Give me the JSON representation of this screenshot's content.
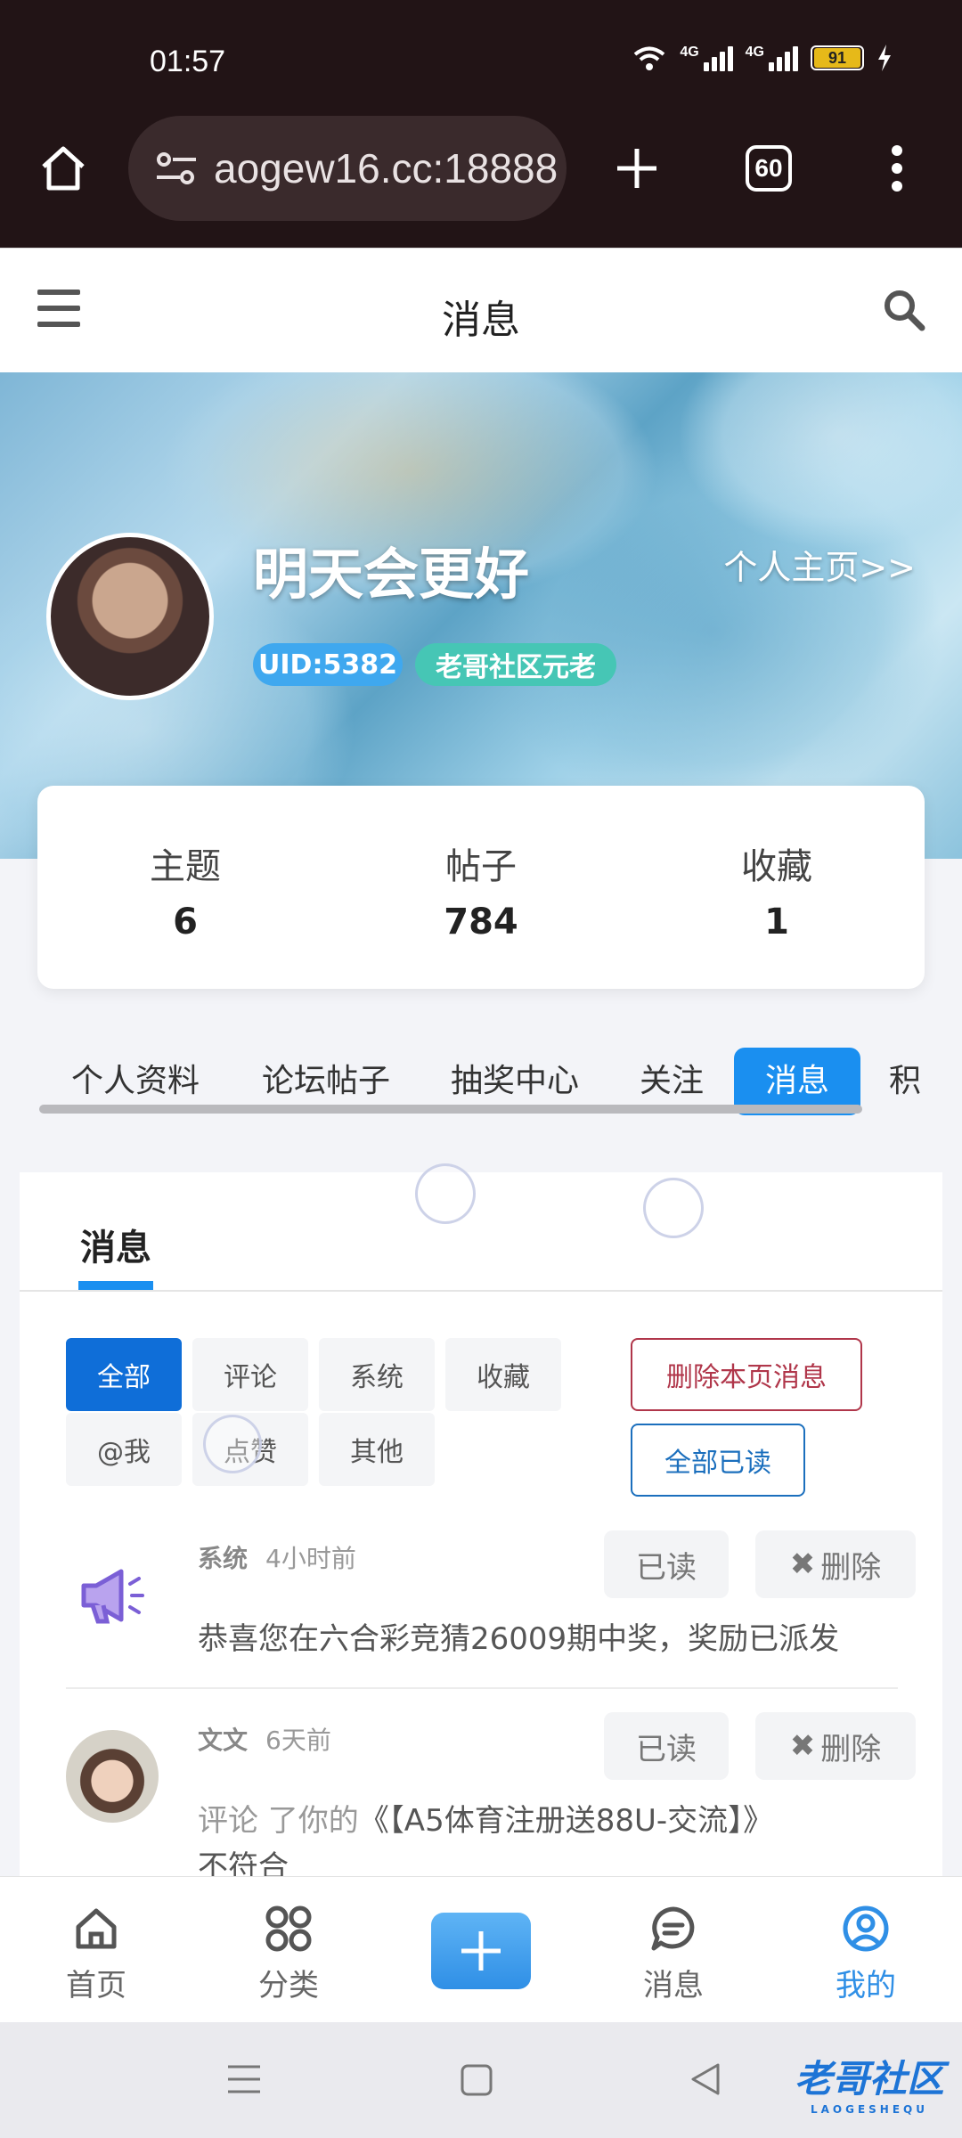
{
  "status_bar": {
    "time": "01:57",
    "battery": "91"
  },
  "browser": {
    "url_text": "aogew16.cc:18888",
    "tab_count": "60"
  },
  "topbar": {
    "title": "消息"
  },
  "profile": {
    "username": "明天会更好",
    "home_link": "个人主页>>",
    "uid_badge": "UID:5382",
    "rank_badge": "老哥社区元老",
    "stats": [
      {
        "label": "主题",
        "value": "6"
      },
      {
        "label": "帖子",
        "value": "784"
      },
      {
        "label": "收藏",
        "value": "1"
      }
    ]
  },
  "profile_tabs": [
    "个人资料",
    "论坛帖子",
    "抽奖中心",
    "关注",
    "消息",
    "积"
  ],
  "messages_panel": {
    "title": "消息",
    "filters": [
      "全部",
      "评论",
      "系统",
      "收藏",
      "@我",
      "点赞",
      "其他"
    ],
    "delete_page_label": "删除本页消息",
    "mark_all_read_label": "全部已读",
    "items": [
      {
        "sender": "系统",
        "time": "4小时前",
        "read_label": "已读",
        "delete_label": "删除",
        "text": "恭喜您在六合彩竞猜26009期中奖，奖励已派发"
      },
      {
        "sender": "文文",
        "time": "6天前",
        "read_label": "已读",
        "delete_label": "删除",
        "text_prefix": "评论 了你的",
        "text_link": "《【A5体育注册送88U-交流】》",
        "text_more": "不符合"
      }
    ]
  },
  "bottom_nav": {
    "home": "首页",
    "category": "分类",
    "messages": "消息",
    "mine": "我的"
  },
  "watermark": {
    "name": "老哥社区",
    "sub": "LAOGESHEQU"
  },
  "colors": {
    "accent": "#1a8ff0",
    "active_filter": "#0f6ed8",
    "delete_border": "#b0364a",
    "read_border": "#1b6fbd",
    "bar_bg": "#221416"
  }
}
